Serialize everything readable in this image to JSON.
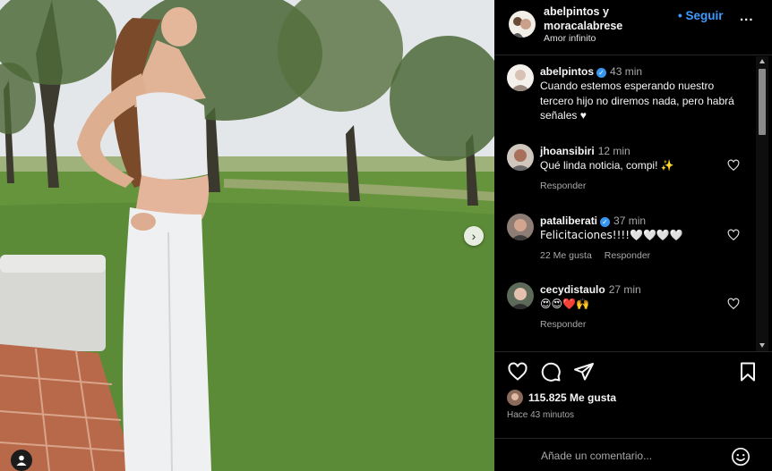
{
  "post": {
    "photo_alt": "Mujer con top blanco y pantalón blanco de pie sobre el césped",
    "carousel_next_icon": "chevron-right-icon",
    "tagged_icon": "user-tag-icon"
  },
  "header": {
    "names": "abelpintos y moracalabrese",
    "subtitle": "Amor infinito",
    "follow_label": "• Seguir",
    "more_label": "..."
  },
  "caption": {
    "username": "abelpintos",
    "verified": true,
    "time": "43 min",
    "text": "Cuando estemos esperando nuestro tercero hijo no diremos nada, pero habrá señales ♥"
  },
  "comments": [
    {
      "username": "jhoansibiri",
      "verified": false,
      "time": "12 min",
      "text": "Qué linda noticia, compi! ✨",
      "reply_label": "Responder",
      "likes_label": ""
    },
    {
      "username": "pataliberati",
      "verified": true,
      "time": "37 min",
      "text": "Felicitaciones!!!!🤍🤍🤍🤍",
      "likes_label": "22 Me gusta",
      "reply_label": "Responder"
    },
    {
      "username": "cecydistaulo",
      "verified": false,
      "time": "27 min",
      "text": "😍😍❤️🙌",
      "reply_label": "Responder",
      "likes_label": ""
    }
  ],
  "actions": {
    "icons": [
      "heart-icon",
      "comment-icon",
      "share-icon",
      "bookmark-icon"
    ]
  },
  "likes": {
    "count_label": "115.825 Me gusta"
  },
  "posted_ago": "Hace 43 minutos",
  "add_comment": {
    "placeholder": "Añade un comentario..."
  },
  "colors": {
    "accent": "#3d9bff",
    "panel_bg": "#000000",
    "muted": "#a8a8a8",
    "verified": "#3797f0"
  }
}
